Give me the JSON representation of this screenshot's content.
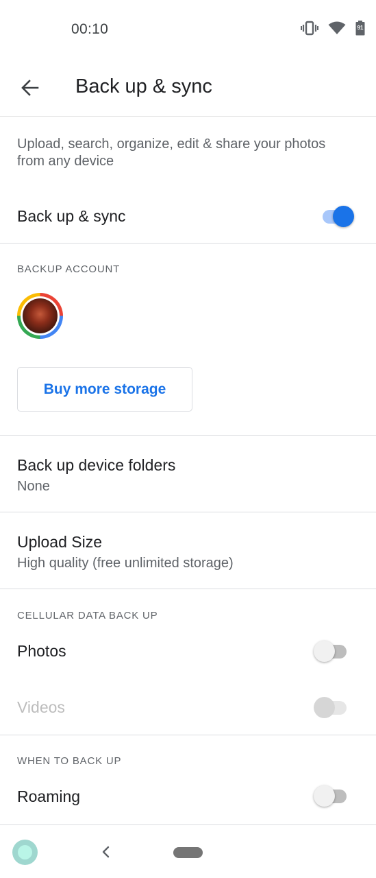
{
  "status_bar": {
    "time": "00:10",
    "icons": [
      "vibrate-icon",
      "wifi-icon",
      "battery-icon"
    ],
    "battery_level": "91"
  },
  "app_bar": {
    "back_icon": "arrow-back-icon",
    "title": "Back up & sync"
  },
  "description": "Upload, search, organize, edit & share your photos from any device",
  "backup_sync": {
    "label": "Back up & sync",
    "enabled": true
  },
  "backup_account": {
    "header": "BACKUP ACCOUNT",
    "avatar_icon": "account-avatar",
    "buy_storage_label": "Buy more storage"
  },
  "device_folders": {
    "title": "Back up device folders",
    "value": "None"
  },
  "upload_size": {
    "title": "Upload Size",
    "value": "High quality (free unlimited storage)"
  },
  "cellular": {
    "header": "CELLULAR DATA BACK UP",
    "photos_label": "Photos",
    "photos_enabled": false,
    "videos_label": "Videos",
    "videos_enabled": false,
    "videos_disabled": true
  },
  "when_to_back_up": {
    "header": "WHEN TO BACK UP",
    "roaming_label": "Roaming",
    "roaming_enabled": false
  },
  "nav_bar": {
    "icons": [
      "assistant-icon",
      "nav-back-icon",
      "home-pill-icon"
    ]
  },
  "colors": {
    "accent": "#1a73e8",
    "text_primary": "#202124",
    "text_secondary": "#5f6368",
    "divider": "#dadce0"
  }
}
